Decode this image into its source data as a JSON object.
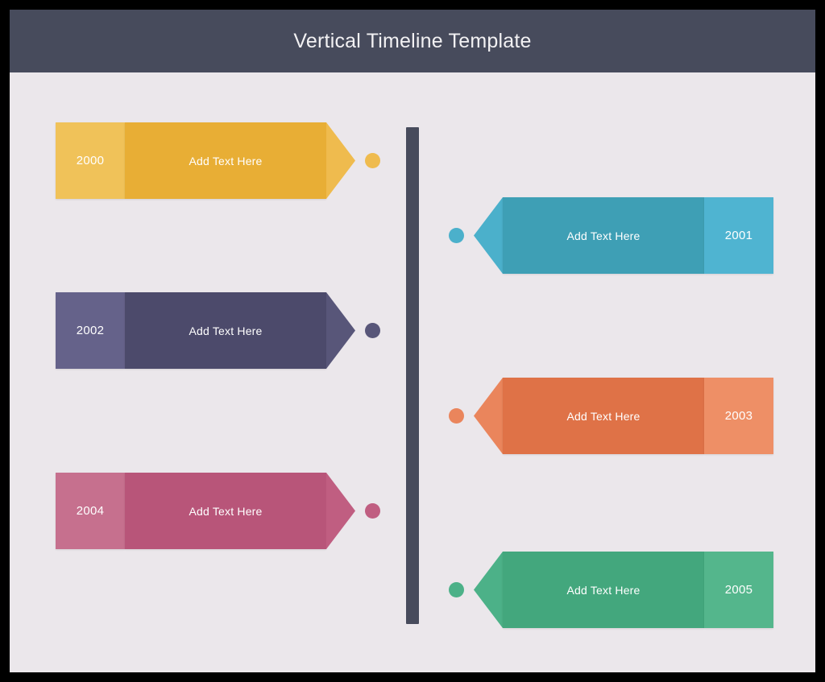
{
  "header": {
    "title": "Vertical Timeline Template",
    "background_color": "#474B5C",
    "text_color": "#F2F1F3"
  },
  "canvas": {
    "background_color": "#EBE7EB",
    "frame_color": "#000000"
  },
  "spine": {
    "name": "vertical-timeline-axis",
    "color": "#474B5C"
  },
  "timeline": {
    "entries": [
      {
        "year": "2000",
        "text": "Add Text Here",
        "side": "left",
        "body_color": "#E8AE35",
        "year_color": "#F0C259",
        "accent_color": "#EFBB4E"
      },
      {
        "year": "2001",
        "text": "Add Text Here",
        "side": "right",
        "body_color": "#3E9FB5",
        "year_color": "#4FB4D1",
        "accent_color": "#4BB0CB"
      },
      {
        "year": "2002",
        "text": "Add Text Here",
        "side": "left",
        "body_color": "#4C4A6B",
        "year_color": "#65628A",
        "accent_color": "#585679"
      },
      {
        "year": "2003",
        "text": "Add Text Here",
        "side": "right",
        "body_color": "#DF7247",
        "year_color": "#EE8F66",
        "accent_color": "#EA855C"
      },
      {
        "year": "2004",
        "text": "Add Text Here",
        "side": "left",
        "body_color": "#B85579",
        "year_color": "#C6708E",
        "accent_color": "#C05E81"
      },
      {
        "year": "2005",
        "text": "Add Text Here",
        "side": "right",
        "body_color": "#43A77D",
        "year_color": "#54B68C",
        "accent_color": "#4CB188"
      }
    ]
  }
}
